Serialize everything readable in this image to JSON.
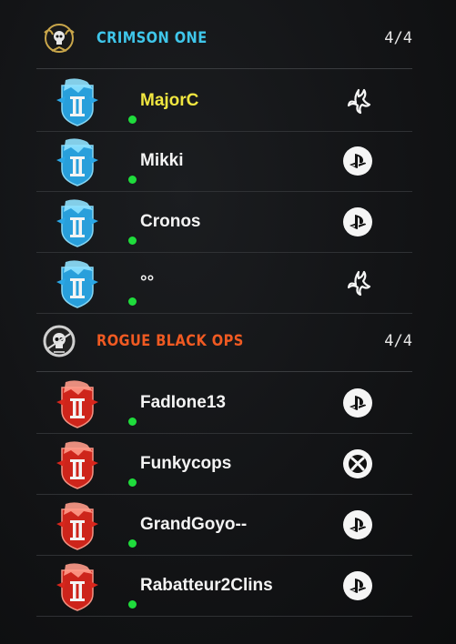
{
  "teams": [
    {
      "name": "CRIMSON ONE",
      "count": "4/4",
      "color": "#3fc6ea",
      "players": [
        {
          "name": "MajorC",
          "platform": "battlenet-icon",
          "self": true,
          "rank_color": "#2aa7e6"
        },
        {
          "name": "Mikki",
          "platform": "playstation-icon",
          "self": false,
          "rank_color": "#2aa7e6"
        },
        {
          "name": "Cronos",
          "platform": "playstation-icon",
          "self": false,
          "rank_color": "#2aa7e6"
        },
        {
          "name": "°°",
          "platform": "battlenet-icon",
          "self": false,
          "rank_color": "#2aa7e6"
        }
      ]
    },
    {
      "name": "ROGUE BLACK OPS",
      "count": "4/4",
      "color": "#f05a22",
      "players": [
        {
          "name": "FadIone13",
          "platform": "playstation-icon",
          "self": false,
          "rank_color": "#d8261c"
        },
        {
          "name": "Funkycops",
          "platform": "xbox-icon",
          "self": false,
          "rank_color": "#d8261c"
        },
        {
          "name": "GrandGoyo--",
          "platform": "playstation-icon",
          "self": false,
          "rank_color": "#d8261c"
        },
        {
          "name": "Rabatteur2Clins",
          "platform": "playstation-icon",
          "self": false,
          "rank_color": "#d8261c"
        }
      ]
    }
  ],
  "status": {
    "online_color": "#1fdc3c",
    "self_name_color": "#f0e640"
  }
}
